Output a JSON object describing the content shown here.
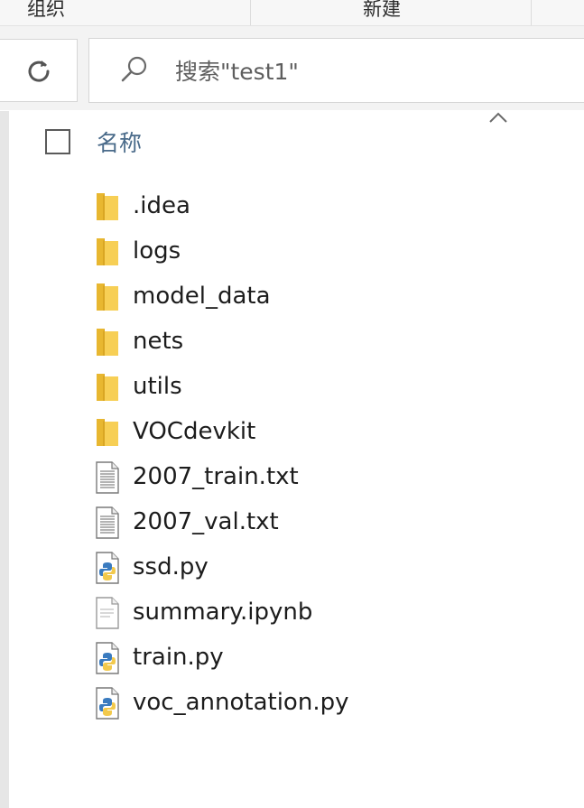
{
  "toolbar": {
    "group_organize": "组织",
    "group_new": "新建"
  },
  "search": {
    "placeholder": "搜索\"test1\""
  },
  "list_header": {
    "name_column": "名称"
  },
  "files": [
    {
      "name": ".idea",
      "icon": "folder-icon"
    },
    {
      "name": "logs",
      "icon": "folder-icon"
    },
    {
      "name": "model_data",
      "icon": "folder-icon"
    },
    {
      "name": "nets",
      "icon": "folder-icon"
    },
    {
      "name": "utils",
      "icon": "folder-icon"
    },
    {
      "name": "VOCdevkit",
      "icon": "folder-icon"
    },
    {
      "name": "2007_train.txt",
      "icon": "text-file-icon"
    },
    {
      "name": "2007_val.txt",
      "icon": "text-file-icon"
    },
    {
      "name": "ssd.py",
      "icon": "python-file-icon"
    },
    {
      "name": "summary.ipynb",
      "icon": "generic-file-icon"
    },
    {
      "name": "train.py",
      "icon": "python-file-icon"
    },
    {
      "name": "voc_annotation.py",
      "icon": "python-file-icon"
    }
  ],
  "colors": {
    "folder": "#f5c842",
    "python_blue": "#3a7bbf",
    "python_yellow": "#f2c94c"
  }
}
